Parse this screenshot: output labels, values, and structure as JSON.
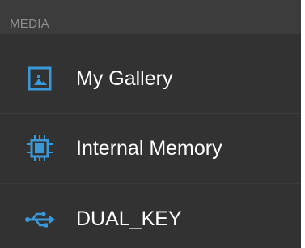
{
  "section": {
    "header": "MEDIA"
  },
  "items": [
    {
      "label": "My Gallery",
      "icon": "image-icon"
    },
    {
      "label": "Internal Memory",
      "icon": "memory-chip-icon"
    },
    {
      "label": "DUAL_KEY",
      "icon": "usb-icon"
    }
  ],
  "colors": {
    "panel_bg": "#323232",
    "header_bg": "#3c3c3c",
    "header_text": "#8e8e8e",
    "item_text": "#ffffff",
    "icon_accent": "#3a9ad9"
  }
}
